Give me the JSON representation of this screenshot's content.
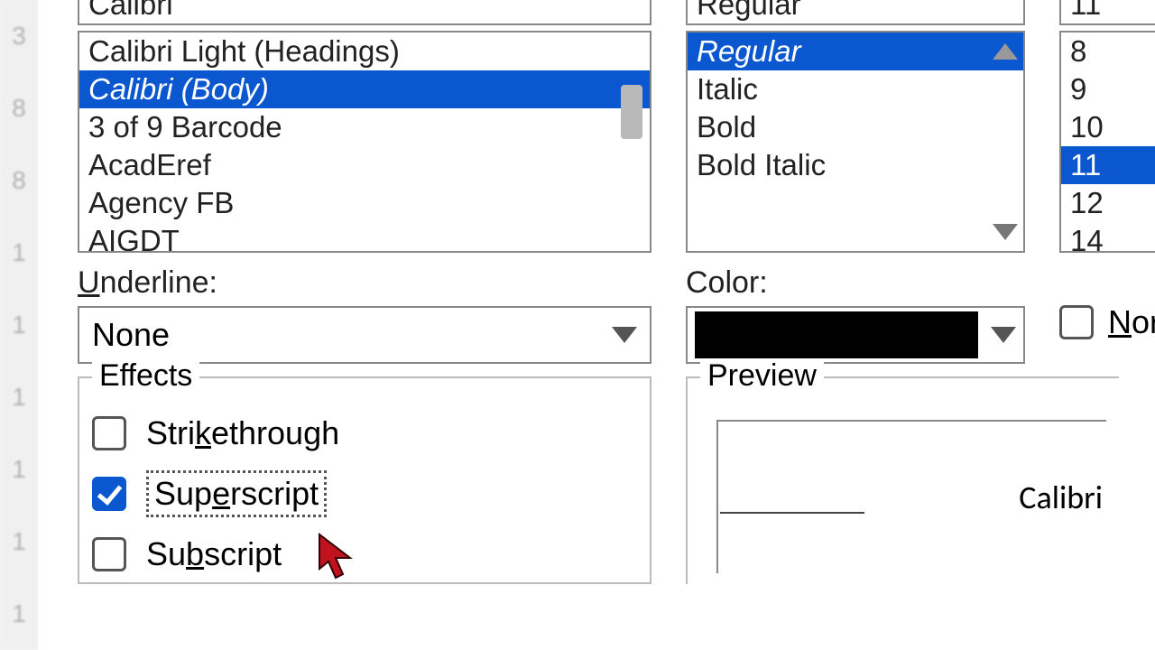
{
  "bg_row_hints": [
    "3",
    "8",
    "8",
    "1",
    "1",
    "1",
    "1",
    "1",
    "1"
  ],
  "font": {
    "input_value": "Calibri",
    "items": [
      {
        "label": "Calibri Light (Headings)",
        "selected": false
      },
      {
        "label": "Calibri (Body)",
        "selected": true
      },
      {
        "label": "3 of 9 Barcode",
        "selected": false
      },
      {
        "label": "AcadEref",
        "selected": false
      },
      {
        "label": "Agency FB",
        "selected": false
      },
      {
        "label": "AIGDT",
        "selected": false
      }
    ]
  },
  "style": {
    "input_value": "Regular",
    "items": [
      {
        "label": "Regular",
        "selected": true
      },
      {
        "label": "Italic",
        "selected": false
      },
      {
        "label": "Bold",
        "selected": false
      },
      {
        "label": "Bold Italic",
        "selected": false
      }
    ]
  },
  "size": {
    "input_value": "11",
    "items": [
      {
        "label": "8",
        "selected": false
      },
      {
        "label": "9",
        "selected": false
      },
      {
        "label": "10",
        "selected": false
      },
      {
        "label": "11",
        "selected": true
      },
      {
        "label": "12",
        "selected": false
      },
      {
        "label": "14",
        "selected": false
      }
    ]
  },
  "underline": {
    "label_pre": "U",
    "label_rest": "nderline:",
    "value": "None"
  },
  "color": {
    "label": "Color:",
    "swatch": "#000000"
  },
  "normal_font": {
    "label_pre": "N",
    "label_rest": "or",
    "checked": false
  },
  "effects": {
    "title": "Effects",
    "strikethrough": {
      "pre": "Stri",
      "u": "k",
      "post": "ethrough",
      "checked": false
    },
    "superscript": {
      "pre": "Sup",
      "u": "e",
      "post": "rscript",
      "checked": true,
      "focused": true
    },
    "subscript": {
      "pre": "Su",
      "u": "b",
      "post": "script",
      "checked": false
    }
  },
  "preview": {
    "title": "Preview",
    "sample": "Calibri"
  }
}
